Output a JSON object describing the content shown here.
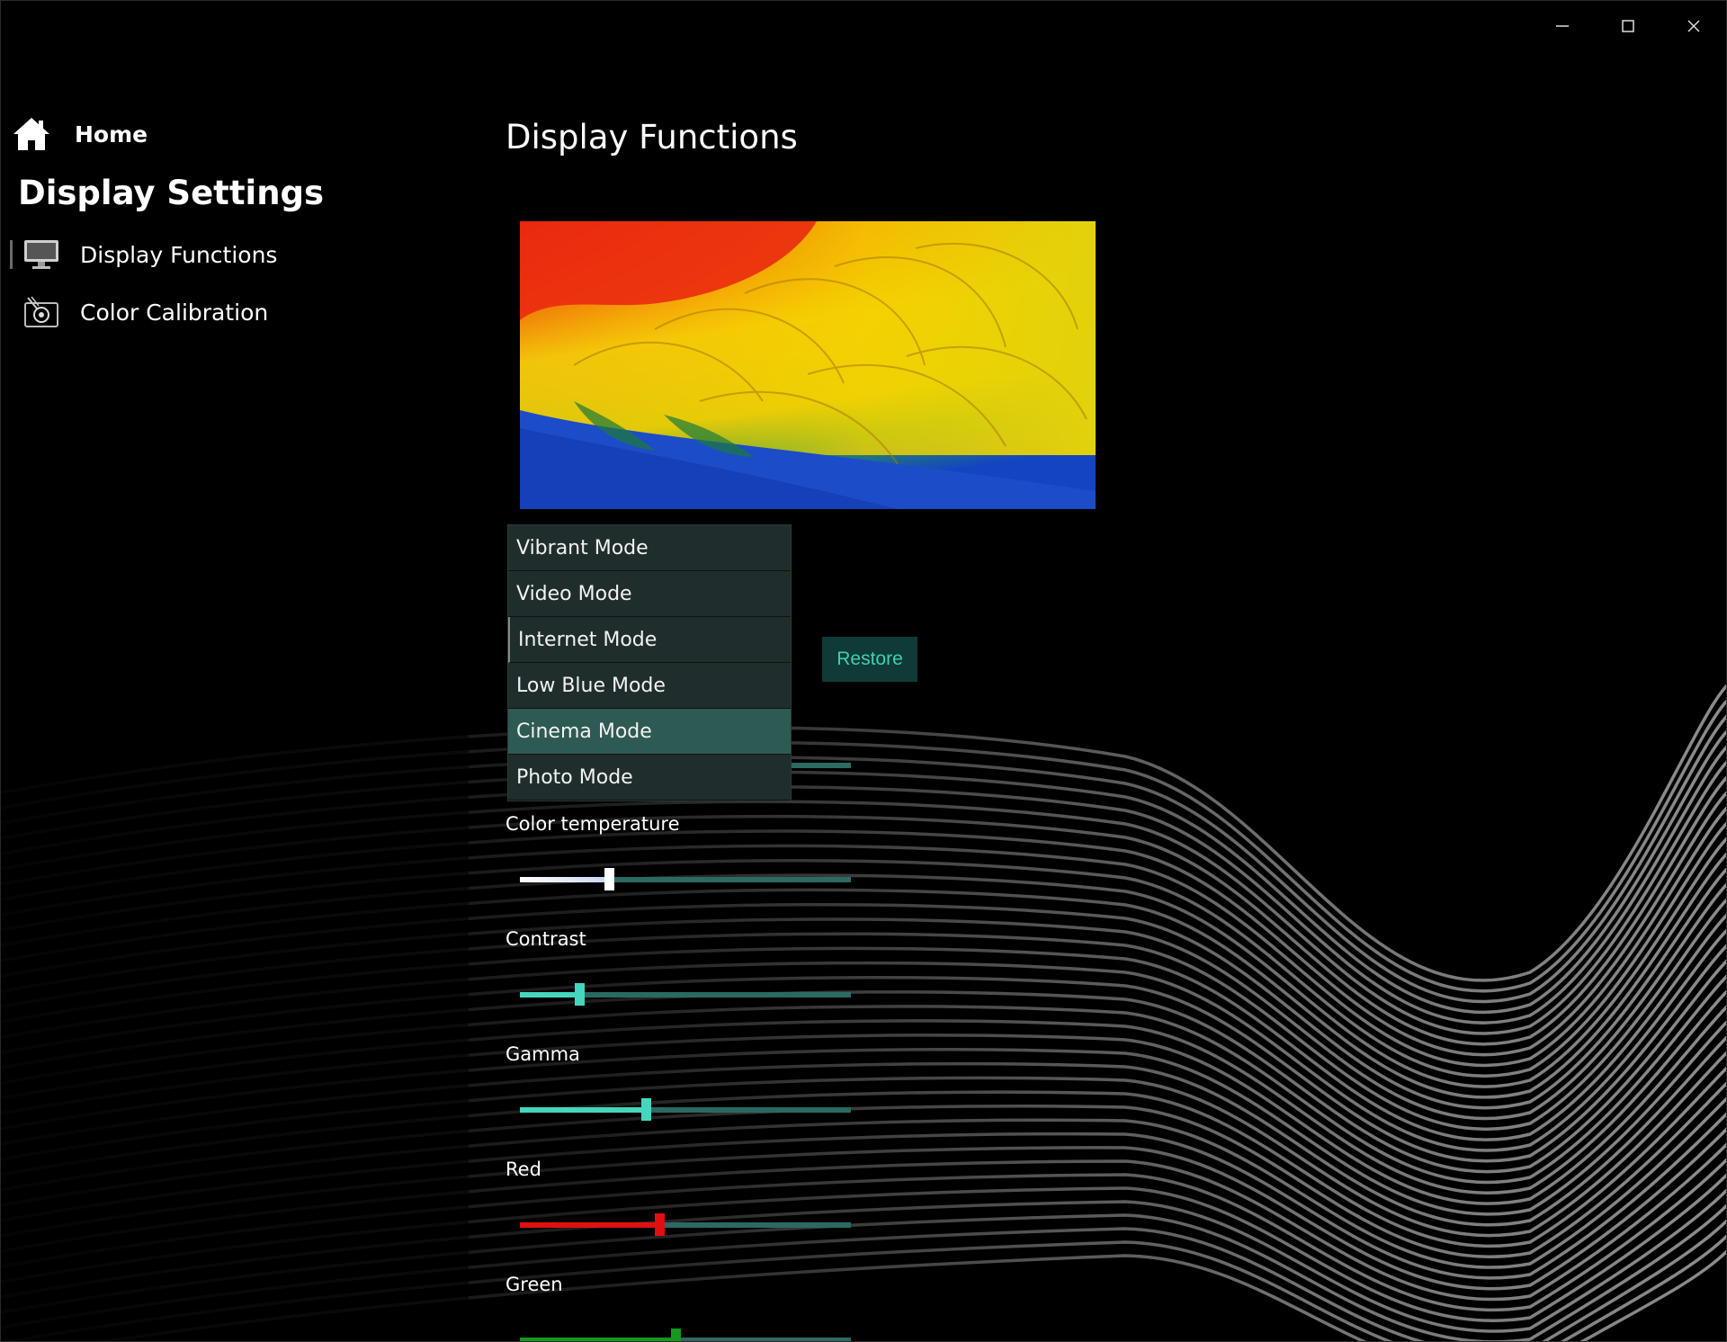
{
  "window": {
    "controls": {
      "minimize": "minimize-icon",
      "maximize": "maximize-icon",
      "close": "close-icon"
    }
  },
  "sidebar": {
    "home_label": "Home",
    "title": "Display Settings",
    "items": [
      {
        "label": "Display Functions",
        "icon": "monitor-icon",
        "selected": true
      },
      {
        "label": "Color Calibration",
        "icon": "color-calibration-icon",
        "selected": false
      }
    ]
  },
  "main": {
    "title": "Display Functions",
    "preview_image": "macaw-feathers-image",
    "mode_dropdown": {
      "options": [
        {
          "label": "Vibrant Mode"
        },
        {
          "label": "Video Mode"
        },
        {
          "label": "Internet Mode"
        },
        {
          "label": "Low Blue Mode"
        },
        {
          "label": "Cinema Mode"
        },
        {
          "label": "Photo Mode"
        }
      ],
      "highlighted": "Cinema Mode"
    },
    "restore_label": "Restore",
    "sliders": [
      {
        "label": "Color temperature",
        "value_fraction": 0.27,
        "fill_color": "#ffffff"
      },
      {
        "label": "Contrast",
        "value_fraction": 0.18,
        "fill_color": "#45d6bd"
      },
      {
        "label": "Gamma",
        "value_fraction": 0.38,
        "fill_color": "#45d6bd"
      },
      {
        "label": "Red",
        "value_fraction": 0.42,
        "fill_color": "#e01010"
      },
      {
        "label": "Green",
        "value_fraction": 0.47,
        "fill_color": "#139a1e"
      }
    ]
  },
  "colors": {
    "accent": "#45d6bd",
    "restore_text": "#3fd0b0",
    "restore_bg": "#0f3a35",
    "dropdown_bg": "#1f2e2c",
    "dropdown_selected": "#2e5a54"
  }
}
